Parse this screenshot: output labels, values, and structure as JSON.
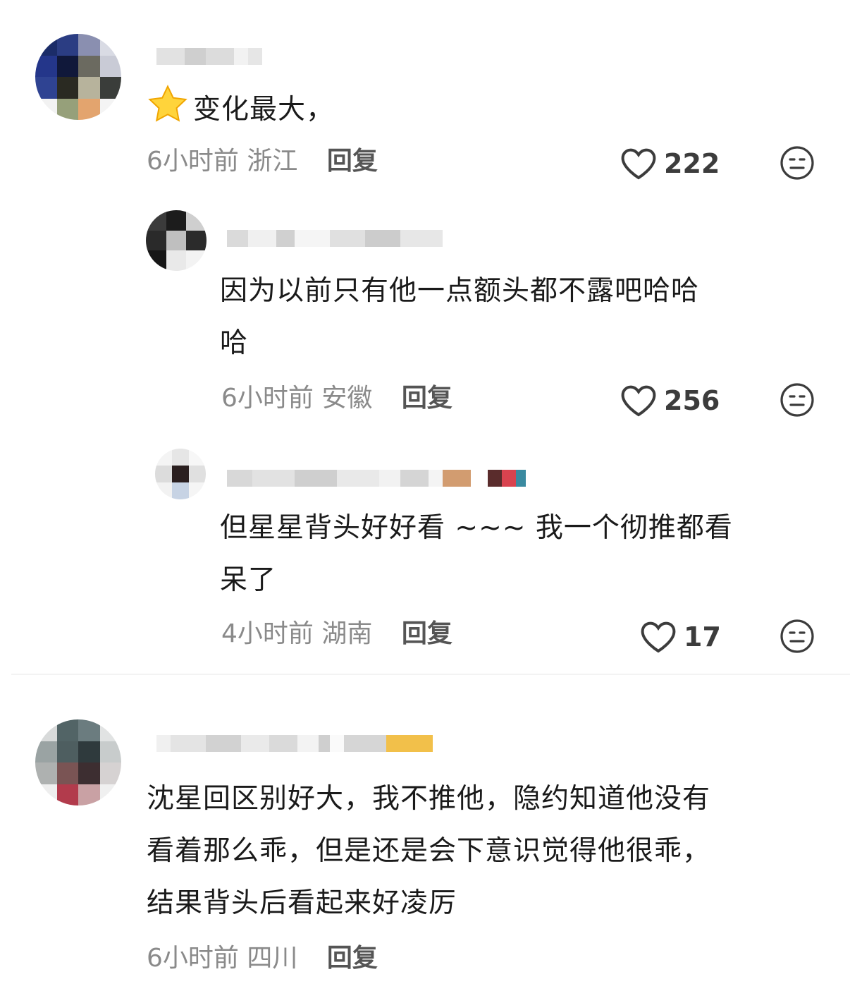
{
  "comments": [
    {
      "text_line1": "变化最大，",
      "time": "6小时前",
      "location": "浙江",
      "reply": "回复",
      "likes": "222",
      "icons": {
        "star": "star-emoji-icon",
        "like": "heart-outline-icon",
        "dislike": "dislike-face-icon"
      }
    },
    {
      "text_line1": "因为以前只有他一点额头都不露吧哈哈",
      "text_line2": "哈",
      "time": "6小时前",
      "location": "安徽",
      "reply": "回复",
      "likes": "256"
    },
    {
      "text_line1": "但星星背头好好看 ~~~ 我一个彻推都看",
      "text_line2": "呆了",
      "time": "4小时前",
      "location": "湖南",
      "reply": "回复",
      "likes": "17"
    },
    {
      "text_line1": "沈星回区别好大，我不推他，隐约知道他没有",
      "text_line2": "看着那么乖，但是还是会下意识觉得他很乖，",
      "text_line3": "结果背头后看起来好凌厉",
      "time": "6小时前",
      "location": "四川",
      "reply": "回复"
    }
  ],
  "colors": {
    "text": "#1a1a1a",
    "meta": "#8a8a8a",
    "reply": "#555555",
    "icon": "#3c3c3c"
  }
}
